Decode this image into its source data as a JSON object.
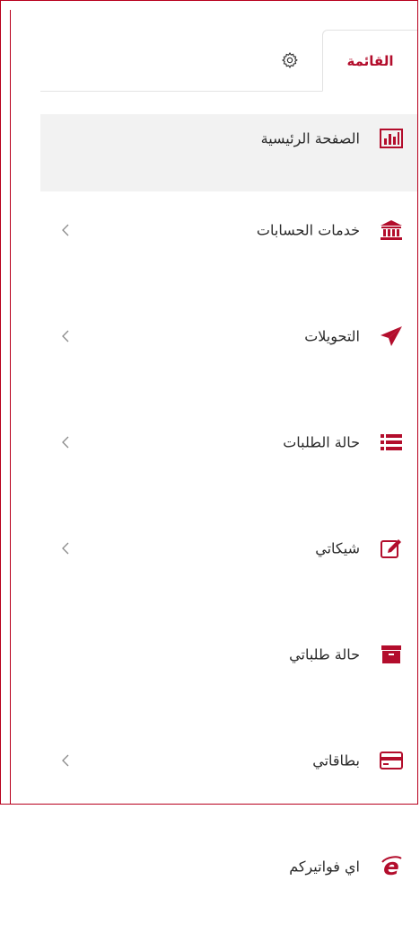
{
  "tabs": {
    "active_label": "القائمة",
    "settings_icon": "gear-icon"
  },
  "menu": {
    "accent_color": "#b30d2c",
    "items": [
      {
        "label": "الصفحة الرئيسية",
        "icon": "chart-bars-icon",
        "has_chevron": false,
        "active": true
      },
      {
        "label": "خدمات الحسابات",
        "icon": "bank-icon",
        "has_chevron": true
      },
      {
        "label": "التحويلات",
        "icon": "paper-plane-icon",
        "has_chevron": true
      },
      {
        "label": "حالة الطلبات",
        "icon": "list-icon",
        "has_chevron": true
      },
      {
        "label": "شيكاتي",
        "icon": "edit-check-icon",
        "has_chevron": true
      },
      {
        "label": "حالة طلباتي",
        "icon": "archive-box-icon",
        "has_chevron": false
      },
      {
        "label": "بطاقاتي",
        "icon": "credit-card-icon",
        "has_chevron": true
      },
      {
        "label": "اي فواتيركم",
        "icon": "e-bills-icon",
        "has_chevron": false
      }
    ]
  }
}
